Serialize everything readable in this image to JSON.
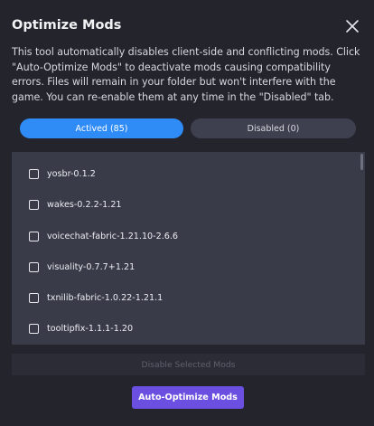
{
  "dialog": {
    "title": "Optimize Mods",
    "description": "This tool automatically disables client-side and conflicting mods. Click \"Auto-Optimize Mods\" to deactivate mods causing compatibility errors. Files will remain in your folder but won't interfere with the game. You can re-enable them at any time in the \"Disabled\" tab."
  },
  "tabs": {
    "active_label": "Actived (85)",
    "disabled_label": "Disabled (0)"
  },
  "mods": [
    {
      "name": "yosbr-0.1.2",
      "checked": false
    },
    {
      "name": "wakes-0.2.2-1.21",
      "checked": false
    },
    {
      "name": "voicechat-fabric-1.21.10-2.6.6",
      "checked": false
    },
    {
      "name": "visuality-0.7.7+1.21",
      "checked": false
    },
    {
      "name": "txnilib-fabric-1.0.22-1.21.1",
      "checked": false
    },
    {
      "name": "tooltipfix-1.1.1-1.20",
      "checked": false
    }
  ],
  "actions": {
    "disable_selected_label": "Disable Selected Mods",
    "auto_optimize_label": "Auto-Optimize Mods"
  },
  "colors": {
    "accent_blue": "#2f8bf5",
    "accent_purple": "#6b4fe0",
    "panel": "#3a3b49",
    "background": "#23242c"
  },
  "icons": {
    "close": "close-icon"
  }
}
